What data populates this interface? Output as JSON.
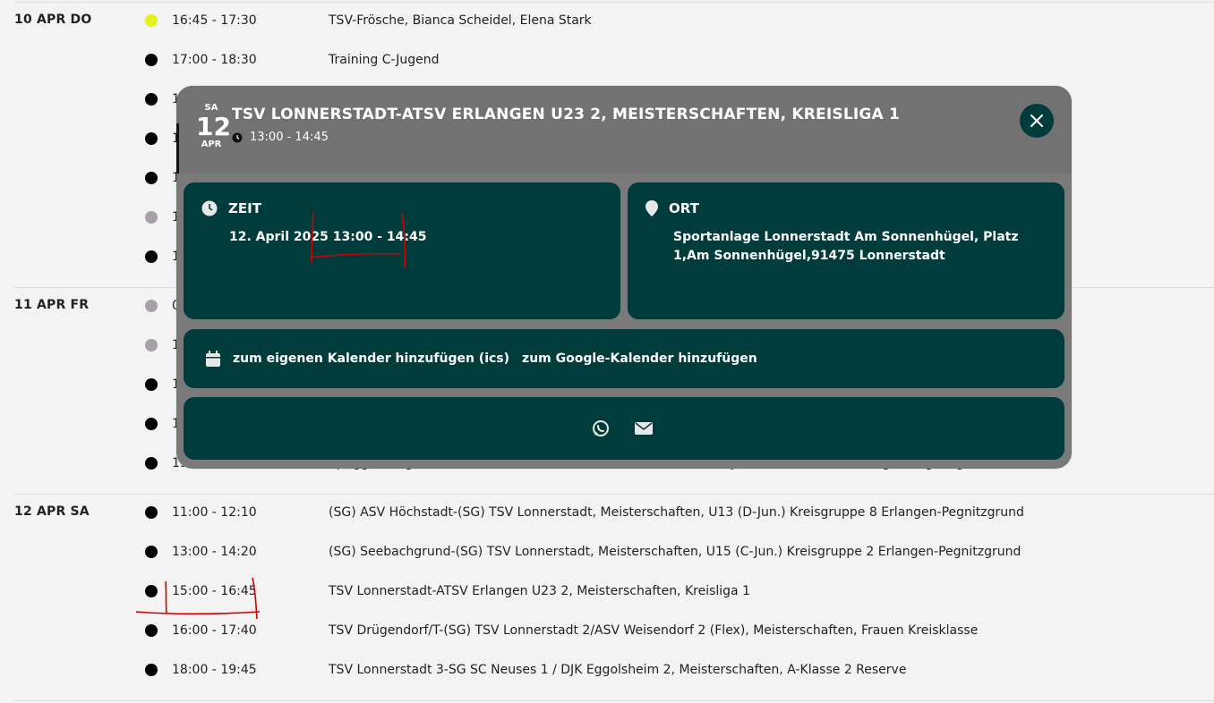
{
  "days": [
    {
      "label": "10 APR DO",
      "events": [
        {
          "time": "16:45 - 17:30",
          "title": "TSV-Frösche, Bianca Scheidel, Elena Stark",
          "dot": "yellow"
        },
        {
          "time": "17:00 - 18:30",
          "title": "Training C-Jugend",
          "dot": "black"
        },
        {
          "time": "1",
          "title": "",
          "dot": "black"
        },
        {
          "time": "1",
          "title": "",
          "dot": "black"
        },
        {
          "time": "1",
          "title": "",
          "dot": "black"
        },
        {
          "time": "1",
          "title": "",
          "dot": "grey"
        },
        {
          "time": "1",
          "title": "",
          "dot": "black"
        }
      ]
    },
    {
      "label": "11 APR FR",
      "events": [
        {
          "time": "0",
          "title": "",
          "dot": "grey"
        },
        {
          "time": "1",
          "title": "",
          "dot": "grey"
        },
        {
          "time": "1",
          "title": "",
          "dot": "black"
        },
        {
          "time": "1",
          "title": "",
          "dot": "black"
        },
        {
          "time": "19:00 - 20:40",
          "title": "SpVgg Erlangen-(SG) TSV Lonnerstadt, Meisterschaften, U19 (A-Jun.) Kreisklasse 3 Erlangen-Pegnitzgrund",
          "dot": "black"
        }
      ]
    },
    {
      "label": "12 APR SA",
      "events": [
        {
          "time": "11:00 - 12:10",
          "title": "(SG) ASV Höchstadt-(SG) TSV Lonnerstadt, Meisterschaften, U13 (D-Jun.) Kreisgruppe 8 Erlangen-Pegnitzgrund",
          "dot": "black"
        },
        {
          "time": "13:00 - 14:20",
          "title": "(SG) Seebachgrund-(SG) TSV Lonnerstadt, Meisterschaften, U15 (C-Jun.) Kreisgruppe 2 Erlangen-Pegnitzgrund",
          "dot": "black"
        },
        {
          "time": "15:00 - 16:45",
          "title": "TSV Lonnerstadt-ATSV Erlangen U23 2, Meisterschaften, Kreisliga 1",
          "dot": "black"
        },
        {
          "time": "16:00 - 17:40",
          "title": "TSV Drügendorf/T-(SG) TSV Lonnerstadt 2/ASV Weisendorf 2 (Flex), Meisterschaften, Frauen Kreisklasse",
          "dot": "black"
        },
        {
          "time": "18:00 - 19:45",
          "title": "TSV Lonnerstadt 3-SG SC Neuses 1 / DJK Eggolsheim 2, Meisterschaften, A-Klasse 2 Reserve",
          "dot": "black"
        }
      ]
    }
  ],
  "modal": {
    "weekday": "SA",
    "day": "12",
    "month": "APR",
    "title": "TSV LONNERSTADT-ATSV ERLANGEN U23 2, MEISTERSCHAFTEN, KREISLIGA 1",
    "time": "13:00 - 14:45",
    "zeit_heading": "ZEIT",
    "zeit_value": "12. April 2025 13:00 - 14:45",
    "ort_heading": "ORT",
    "ort_value": "Sportanlage Lonnerstadt Am Sonnenhügel, Platz 1,Am Sonnenhügel,91475 Lonnerstadt",
    "ics_link": "zum eigenen Kalender hinzufügen (ics)",
    "google_link": "zum Google-Kalender hinzufügen"
  },
  "icons": [
    "clock-icon",
    "map-pin-icon",
    "calendar-icon",
    "close-icon",
    "whatsapp-icon",
    "mail-icon"
  ],
  "colors": {
    "page_bg": "#f3f3f3",
    "modal_bg": "#7a7a7a",
    "card_bg": "#003c3c",
    "dot_yellow": "#e6f21b",
    "dot_grey": "#a89fa9",
    "annotation_red": "#d40000"
  }
}
